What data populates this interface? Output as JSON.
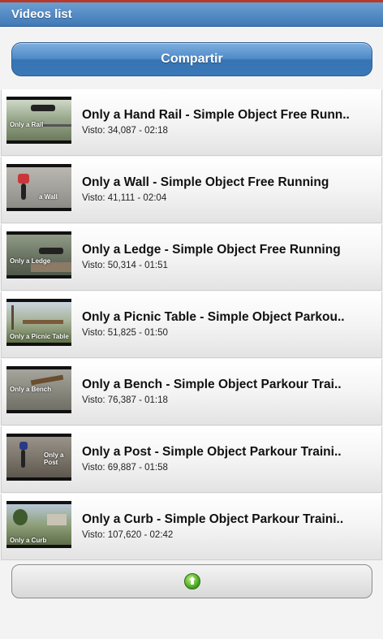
{
  "header": {
    "title": "Videos list"
  },
  "share": {
    "label": "Compartir"
  },
  "videos": [
    {
      "title": "Only a Hand Rail - Simple Object Free Runn..",
      "meta": "Visto: 34,087 - 02:18",
      "thumb_caption": "Only a Rail"
    },
    {
      "title": "Only a Wall - Simple Object Free Running",
      "meta": "Visto: 41,111 - 02:04",
      "thumb_caption": "a Wall"
    },
    {
      "title": "Only a Ledge - Simple Object Free Running",
      "meta": "Visto: 50,314 - 01:51",
      "thumb_caption": "Only a Ledge"
    },
    {
      "title": "Only a Picnic Table - Simple Object Parkou..",
      "meta": "Visto: 51,825 - 01:50",
      "thumb_caption": "Only a Picnic Table"
    },
    {
      "title": "Only a Bench - Simple Object Parkour Trai..",
      "meta": "Visto: 76,387 - 01:18",
      "thumb_caption": "Only a Bench"
    },
    {
      "title": "Only a Post - Simple Object Parkour Traini..",
      "meta": "Visto: 69,887 - 01:58",
      "thumb_caption": "Only a Post"
    },
    {
      "title": "Only a Curb - Simple Object Parkour Traini..",
      "meta": "Visto: 107,620 - 02:42",
      "thumb_caption": "Only a Curb"
    }
  ],
  "footer": {
    "icon": "load-more-icon"
  }
}
